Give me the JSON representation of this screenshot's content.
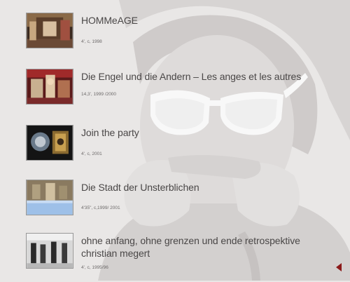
{
  "works": [
    {
      "title": "HOMMeAGE",
      "meta": "4', c, 1998",
      "thumb_icon": "hommeage-thumbnail"
    },
    {
      "title": "Die Engel und die Andern – Les anges et les autres",
      "meta": "14,3', 1999 /2000",
      "thumb_icon": "engel-thumbnail"
    },
    {
      "title": "Join the party",
      "meta": "4', c, 2001",
      "thumb_icon": "join-the-party-thumbnail"
    },
    {
      "title": "Die Stadt der Unsterblichen",
      "meta": "4'35\", c,1999/ 2001",
      "thumb_icon": "stadt-thumbnail"
    },
    {
      "title": "ohne anfang, ohne grenzen und ende retrospektive christian megert",
      "meta": "4', c, 1995/96",
      "thumb_icon": "ohne-anfang-thumbnail"
    }
  ],
  "nav": {
    "icon": "back-arrow-icon",
    "color": "#8b1a1a"
  },
  "colors": {
    "background": "#e9e7e6",
    "title": "#4a4747",
    "meta": "#6d6a6a"
  }
}
